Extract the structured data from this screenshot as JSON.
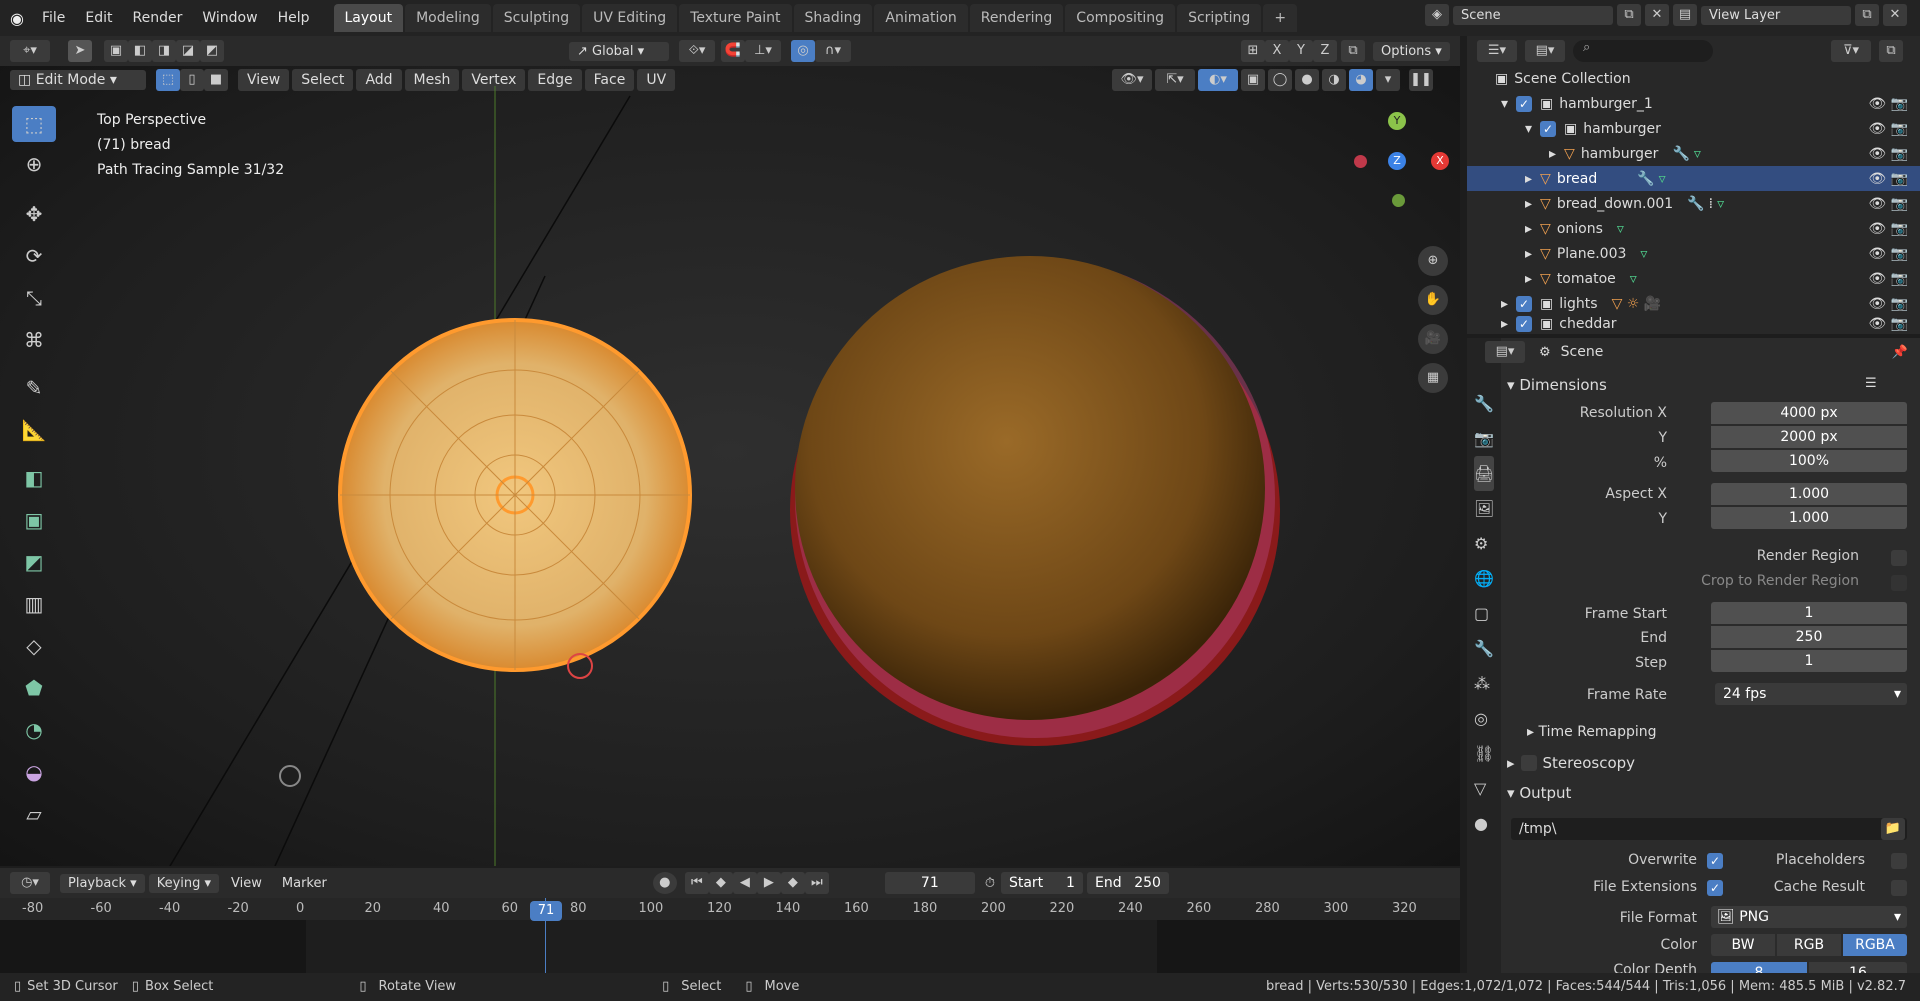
{
  "menubar": {
    "items": [
      "File",
      "Edit",
      "Render",
      "Window",
      "Help"
    ]
  },
  "workspaces": [
    "Layout",
    "Modeling",
    "Sculpting",
    "UV Editing",
    "Texture Paint",
    "Shading",
    "Animation",
    "Rendering",
    "Compositing",
    "Scripting"
  ],
  "active_workspace": "Layout",
  "scene": "Scene",
  "view_layer": "View Layer",
  "toolbar": {
    "transform": "Global",
    "axes": [
      "X",
      "Y",
      "Z"
    ],
    "options": "Options"
  },
  "viewport": {
    "mode": "Edit Mode",
    "menus": [
      "View",
      "Select",
      "Add",
      "Mesh",
      "Vertex",
      "Edge",
      "Face",
      "UV"
    ],
    "overlay_lines": [
      "Top Perspective",
      "(71) bread",
      "Path Tracing Sample 31/32"
    ]
  },
  "gizmo": {
    "y": "Y",
    "z": "Z",
    "x": "X"
  },
  "outliner": {
    "root": "Scene Collection",
    "rows": [
      {
        "label": "hamburger_1",
        "selected": false
      },
      {
        "label": "hamburger",
        "selected": false
      },
      {
        "label": "hamburger",
        "selected": false
      },
      {
        "label": "bread",
        "selected": true
      },
      {
        "label": "bread_down.001",
        "selected": false
      },
      {
        "label": "onions",
        "selected": false
      },
      {
        "label": "Plane.003",
        "selected": false
      },
      {
        "label": "tomatoe",
        "selected": false
      },
      {
        "label": "lights",
        "selected": false
      },
      {
        "label": "cheddar",
        "selected": false
      }
    ]
  },
  "properties": {
    "context": "Scene",
    "dimensions": {
      "header": "Dimensions",
      "res_x_label": "Resolution X",
      "res_x": "4000 px",
      "y_label": "Y",
      "res_y": "2000 px",
      "pct_label": "%",
      "pct": "100%",
      "aspect_x_label": "Aspect X",
      "aspect_x": "1.000",
      "aspect_y_label": "Y",
      "aspect_y": "1.000",
      "render_region": "Render Region",
      "crop": "Crop to Render Region",
      "frame_start_label": "Frame Start",
      "frame_start": "1",
      "end_label": "End",
      "end": "250",
      "step_label": "Step",
      "step": "1",
      "frame_rate_label": "Frame Rate",
      "frame_rate": "24 fps"
    },
    "time_remapping": "Time Remapping",
    "stereoscopy": "Stereoscopy",
    "output": {
      "header": "Output",
      "path": "/tmp\\",
      "overwrite": "Overwrite",
      "placeholders": "Placeholders",
      "file_ext": "File Extensions",
      "cache": "Cache Result",
      "file_format_label": "File Format",
      "file_format": "PNG",
      "color_label": "Color",
      "color_opts": [
        "BW",
        "RGB",
        "RGBA"
      ],
      "color_depth_label": "Color Depth",
      "depth_opts": [
        "8",
        "16"
      ]
    }
  },
  "timeline": {
    "menus": [
      "Playback",
      "Keying",
      "View",
      "Marker"
    ],
    "current_frame": "71",
    "start_label": "Start",
    "start": "1",
    "end_label": "End",
    "end": "250",
    "ticks": [
      "-80",
      "-60",
      "-40",
      "-20",
      "0",
      "20",
      "40",
      "60",
      "80",
      "100",
      "120",
      "140",
      "160",
      "180",
      "200",
      "220",
      "240",
      "260",
      "280",
      "300",
      "320"
    ]
  },
  "status": {
    "left": [
      "Set 3D Cursor",
      "Box Select",
      "Rotate View",
      "Select",
      "Move"
    ],
    "right": "bread | Verts:530/530 | Edges:1,072/1,072 | Faces:544/544 | Tris:1,056 | Mem: 485.5 MiB | v2.82.7"
  },
  "colors": {
    "accent": "#4b7ec4",
    "select_orange": "#ff9a2e"
  }
}
